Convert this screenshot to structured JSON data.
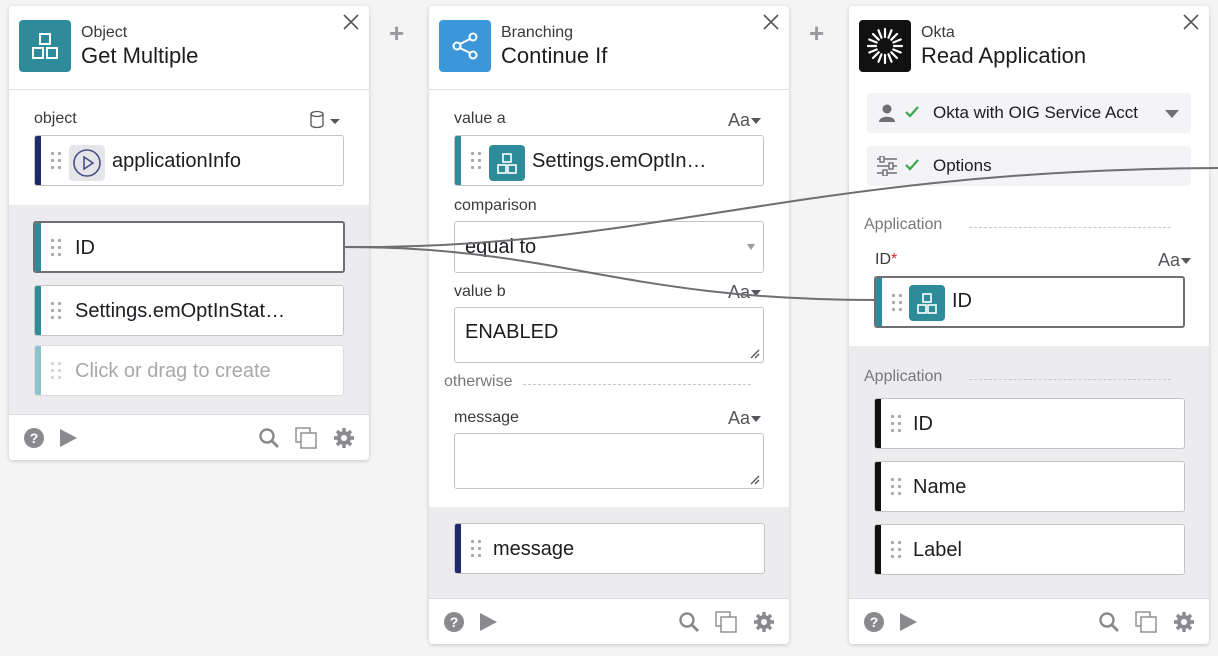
{
  "toolbar": {
    "add_step": "+"
  },
  "card1": {
    "subtitle": "Object",
    "title": "Get Multiple",
    "object_label": "object",
    "object_input": "applicationInfo",
    "outputs": [
      "ID",
      "Settings.emOptInStat…"
    ],
    "placeholder": "Click or drag to create"
  },
  "card2": {
    "subtitle": "Branching",
    "title": "Continue If",
    "value_a_label": "value a",
    "value_a": "Settings.emOptIn…",
    "comparison_label": "comparison",
    "comparison": "equal to",
    "value_b_label": "value b",
    "value_b": "ENABLED",
    "otherwise_label": "otherwise",
    "message_label": "message",
    "message": "",
    "output_message": "message",
    "type_label": "Aa"
  },
  "card3": {
    "subtitle": "Okta",
    "title": "Read Application",
    "connection": "Okta with OIG Service Acct",
    "options": "Options",
    "input_section": "Application",
    "id_label": "ID",
    "required_mark": "*",
    "id_input": "ID",
    "output_section": "Application",
    "outputs": [
      "ID",
      "Name",
      "Label"
    ],
    "type_label": "Aa"
  },
  "colors": {
    "teal": "#2e8b99",
    "navy": "#1f2a6b",
    "okta_black": "#111111",
    "branch_blue": "#3b97d9",
    "check_green": "#3aa64d"
  }
}
